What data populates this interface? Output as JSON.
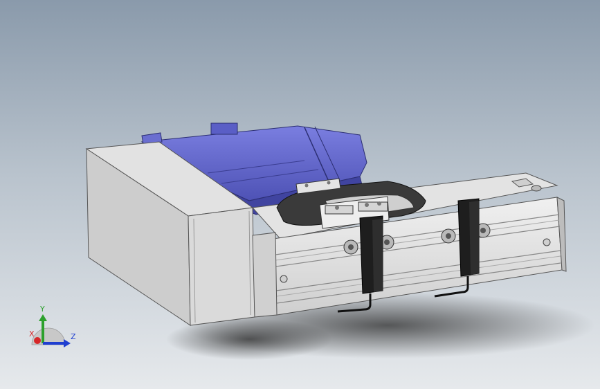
{
  "viewport": {
    "background_top": "#8a9aab",
    "background_bottom": "#e6e9ec"
  },
  "model": {
    "motor_color": "#6367c8",
    "housing_color": "#d7d7d7",
    "rail_color": "#dcdcdc",
    "sensor_color": "#1e1e1e"
  },
  "triad": {
    "y_label": "Y",
    "x_label": "X",
    "z_label": "Z",
    "y_color": "#2ca02c",
    "x_color": "#d62728",
    "z_color": "#1f3fd0"
  }
}
